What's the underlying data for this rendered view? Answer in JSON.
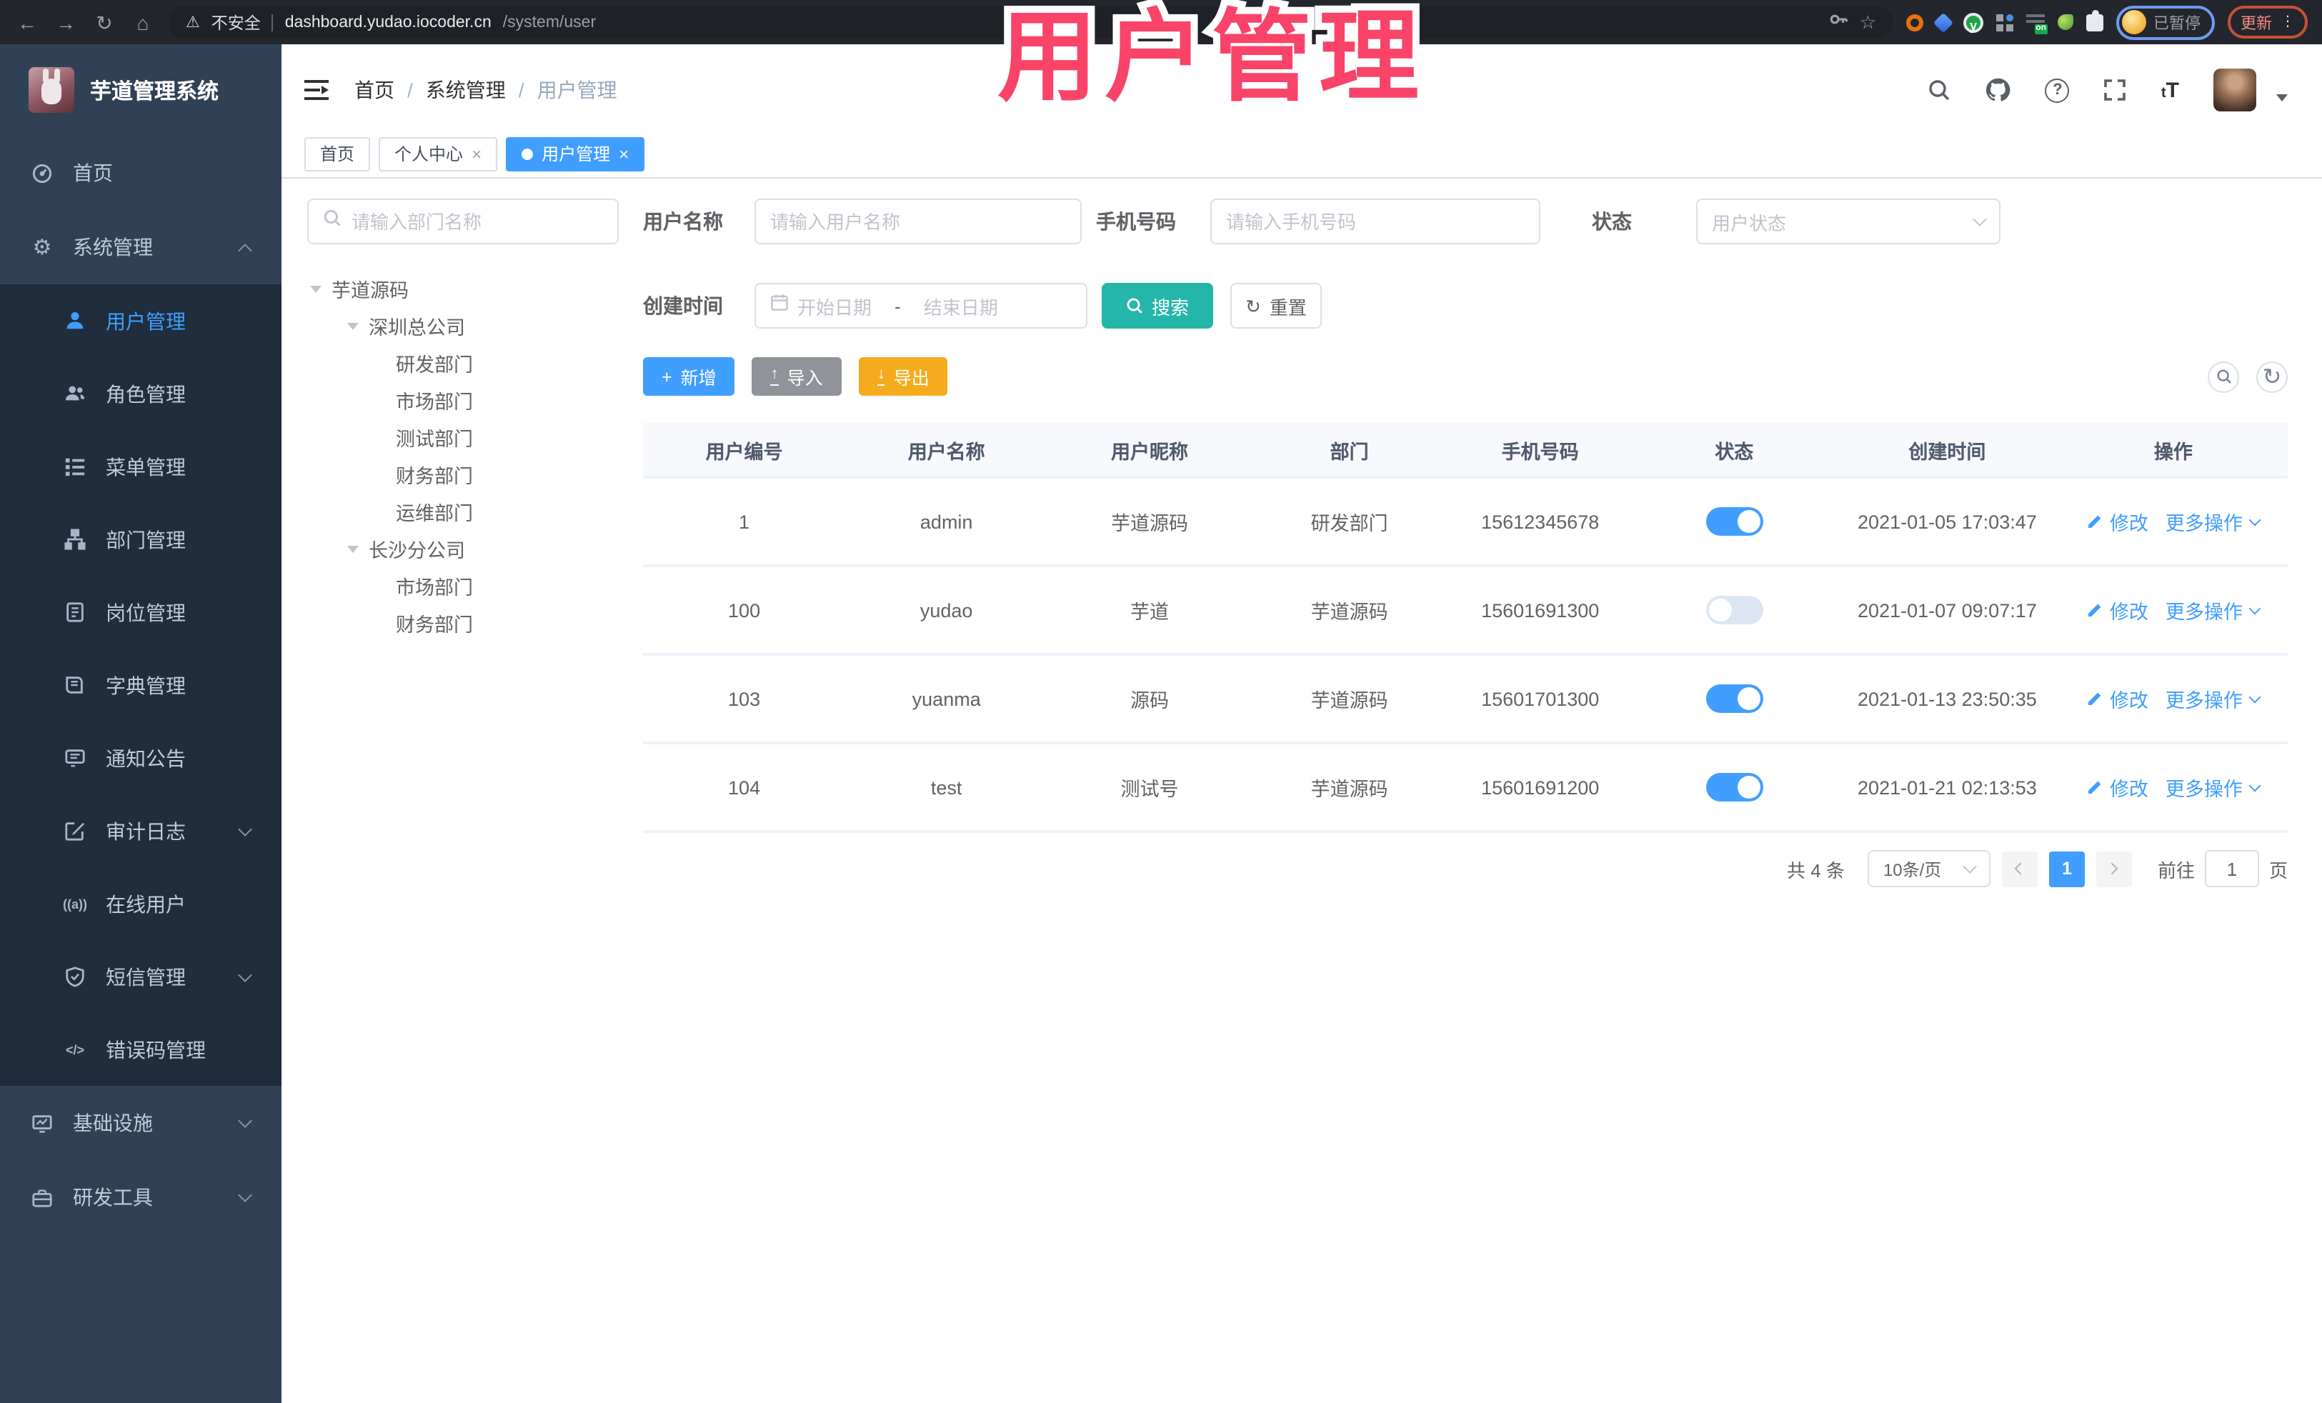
{
  "browser": {
    "security_label": "不安全",
    "url_host": "dashboard.yudao.iocoder.cn",
    "url_path": "/system/user",
    "extension_badge": "on",
    "profile_status": "已暂停",
    "update_label": "更新"
  },
  "overlay": {
    "title": "用户管理"
  },
  "header": {
    "app_title": "芋道管理系统",
    "breadcrumb": {
      "home": "首页",
      "section": "系统管理",
      "current": "用户管理"
    },
    "help_glyph": "?"
  },
  "tabs": {
    "home": "首页",
    "profile": "个人中心",
    "current": "用户管理"
  },
  "sidebar": {
    "items": [
      {
        "label": "首页"
      },
      {
        "label": "系统管理"
      },
      {
        "label": "用户管理"
      },
      {
        "label": "角色管理"
      },
      {
        "label": "菜单管理"
      },
      {
        "label": "部门管理"
      },
      {
        "label": "岗位管理"
      },
      {
        "label": "字典管理"
      },
      {
        "label": "通知公告"
      },
      {
        "label": "审计日志"
      },
      {
        "label": "在线用户"
      },
      {
        "label": "短信管理"
      },
      {
        "label": "错误码管理"
      },
      {
        "label": "基础设施"
      },
      {
        "label": "研发工具"
      }
    ]
  },
  "tree": {
    "search_placeholder": "请输入部门名称",
    "nodes": [
      {
        "label": "芋道源码"
      },
      {
        "label": "深圳总公司"
      },
      {
        "label": "研发部门"
      },
      {
        "label": "市场部门"
      },
      {
        "label": "测试部门"
      },
      {
        "label": "财务部门"
      },
      {
        "label": "运维部门"
      },
      {
        "label": "长沙分公司"
      },
      {
        "label": "市场部门"
      },
      {
        "label": "财务部门"
      }
    ]
  },
  "filters": {
    "username_label": "用户名称",
    "username_placeholder": "请输入用户名称",
    "mobile_label": "手机号码",
    "mobile_placeholder": "请输入手机号码",
    "status_label": "状态",
    "status_placeholder": "用户状态",
    "created_label": "创建时间",
    "date_start_placeholder": "开始日期",
    "date_separator": "-",
    "date_end_placeholder": "结束日期",
    "search_button": "搜索",
    "reset_button": "重置"
  },
  "toolbar": {
    "add": "新增",
    "import": "导入",
    "export": "导出"
  },
  "table": {
    "headers": [
      "用户编号",
      "用户名称",
      "用户昵称",
      "部门",
      "手机号码",
      "状态",
      "创建时间",
      "操作"
    ],
    "actions": {
      "modify": "修改",
      "more": "更多操作"
    },
    "rows": [
      {
        "id": "1",
        "username": "admin",
        "nickname": "芋道源码",
        "dept": "研发部门",
        "mobile": "15612345678",
        "status": true,
        "created": "2021-01-05 17:03:47"
      },
      {
        "id": "100",
        "username": "yudao",
        "nickname": "芋道",
        "dept": "芋道源码",
        "mobile": "15601691300",
        "status": false,
        "created": "2021-01-07 09:07:17"
      },
      {
        "id": "103",
        "username": "yuanma",
        "nickname": "源码",
        "dept": "芋道源码",
        "mobile": "15601701300",
        "status": true,
        "created": "2021-01-13 23:50:35"
      },
      {
        "id": "104",
        "username": "test",
        "nickname": "测试号",
        "dept": "芋道源码",
        "mobile": "15601691200",
        "status": true,
        "created": "2021-01-21 02:13:53"
      }
    ]
  },
  "pagination": {
    "total": "共 4 条",
    "page_size": "10条/页",
    "current_page": "1",
    "goto_label": "前往",
    "goto_value": "1",
    "page_unit": "页"
  },
  "colors": {
    "primary": "#409EFF",
    "search_teal": "#24B6A8",
    "export_amber": "#F5AB1E",
    "import_gray": "#909399",
    "sidebar_bg": "#304156",
    "submenu_bg": "#1F2D3D",
    "overlay_pink": "#F94368"
  }
}
